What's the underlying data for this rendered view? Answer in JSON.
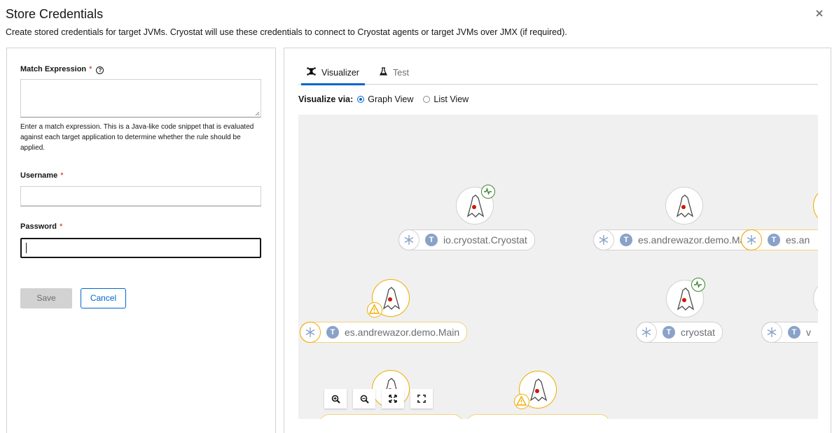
{
  "modal": {
    "title": "Store Credentials",
    "description": "Create stored credentials for target JVMs. Cryostat will use these credentials to connect to Cryostat agents or target JVMs over JMX (if required).",
    "close_icon": "close-icon"
  },
  "form": {
    "match_expression": {
      "label": "Match Expression",
      "required_mark": "*",
      "value": "",
      "helper": "Enter a match expression. This is a Java-like code snippet that is evaluated against each target application to determine whether the rule should be applied."
    },
    "username": {
      "label": "Username",
      "required_mark": "*",
      "value": ""
    },
    "password": {
      "label": "Password",
      "required_mark": "*",
      "value": ""
    },
    "save_label": "Save",
    "cancel_label": "Cancel"
  },
  "tabs": [
    {
      "label": "Visualizer",
      "icon": "topology-icon",
      "active": true
    },
    {
      "label": "Test",
      "icon": "flask-icon",
      "active": false
    }
  ],
  "visualize": {
    "label": "Visualize via:",
    "options": [
      {
        "label": "Graph View",
        "checked": true
      },
      {
        "label": "List View",
        "checked": false
      }
    ]
  },
  "graph": {
    "nodes": [
      {
        "label": "io.cryostat.Cryostat",
        "status": "ok",
        "badge": "T"
      },
      {
        "label": "es.andrewazor.demo.Main",
        "status": "none",
        "badge": "T"
      },
      {
        "label": "es.an",
        "status": "warn",
        "badge": "T"
      },
      {
        "label": "es.andrewazor.demo.Main",
        "status": "warn",
        "badge": "T"
      },
      {
        "label": "cryostat",
        "status": "ok",
        "badge": "T"
      },
      {
        "label": "v",
        "status": "none",
        "badge": "T"
      }
    ],
    "controls": [
      "zoom-in-icon",
      "zoom-out-icon",
      "fit-to-screen-icon",
      "reset-view-icon"
    ]
  },
  "colors": {
    "primary": "#0066cc",
    "warning": "#f0ab00",
    "success": "#3e8635",
    "danger": "#c9190b"
  }
}
